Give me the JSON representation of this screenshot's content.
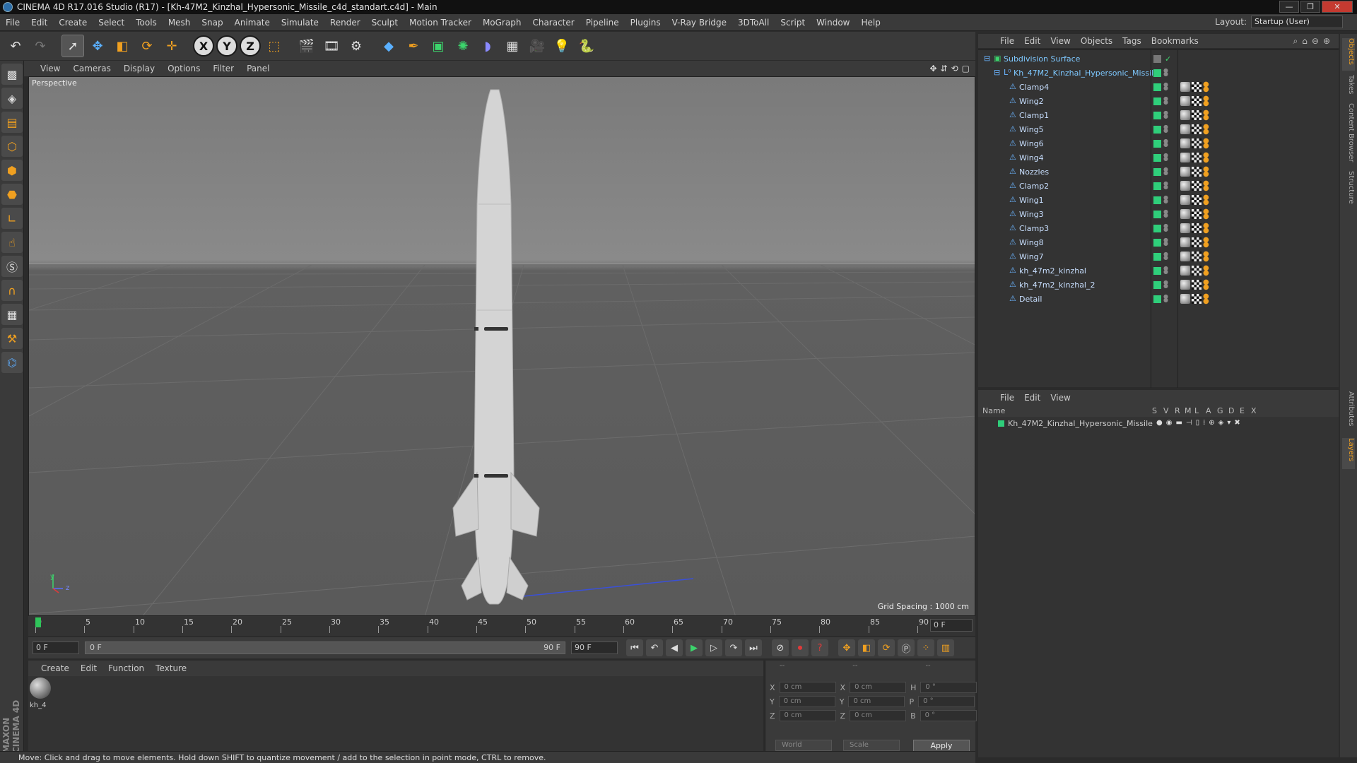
{
  "window": {
    "title": "CINEMA 4D R17.016 Studio (R17) - [Kh-47M2_Kinzhal_Hypersonic_Missile_c4d_standart.c4d] - Main"
  },
  "menubar": {
    "items": [
      "File",
      "Edit",
      "Create",
      "Select",
      "Tools",
      "Mesh",
      "Snap",
      "Animate",
      "Simulate",
      "Render",
      "Sculpt",
      "Motion Tracker",
      "MoGraph",
      "Character",
      "Pipeline",
      "Plugins",
      "V-Ray Bridge",
      "3DToAll",
      "Script",
      "Window",
      "Help"
    ],
    "layout_label": "Layout:",
    "layout_value": "Startup (User)"
  },
  "toolbar": {
    "icons": [
      "undo-icon",
      "redo-icon",
      "select-arrow-icon",
      "move-icon",
      "scale-icon",
      "rotate-icon",
      "add-icon",
      "x-axis-icon",
      "y-axis-icon",
      "z-axis-icon",
      "coordinate-system-icon",
      "render-view-icon",
      "render-picture-viewer-icon",
      "render-settings-icon",
      "cube-primitive-icon",
      "spline-pen-icon",
      "subdivision-icon",
      "cloner-icon",
      "deformer-icon",
      "floor-icon",
      "camera-icon",
      "light-icon",
      "python-icon"
    ],
    "axis_labels": [
      "X",
      "Y",
      "Z"
    ]
  },
  "left_tools": [
    "model-mode-icon",
    "texture-mode-icon",
    "workplane-icon",
    "points-mode-icon",
    "edges-mode-icon",
    "polygons-mode-icon",
    "axis-mode-icon",
    "tweak-icon",
    "soft-selection-icon",
    "magnet-icon",
    "snap-grid-icon",
    "snap-settings-icon",
    "python-script-icon"
  ],
  "viewport": {
    "menus": [
      "View",
      "Cameras",
      "Display",
      "Options",
      "Filter",
      "Panel"
    ],
    "label": "Perspective",
    "grid_spacing": "Grid Spacing : 1000 cm",
    "axis_y": "y",
    "axis_z": "z"
  },
  "timeline": {
    "ticks": [
      "0",
      "5",
      "10",
      "15",
      "20",
      "25",
      "30",
      "35",
      "40",
      "45",
      "50",
      "55",
      "60",
      "65",
      "70",
      "75",
      "80",
      "85",
      "90"
    ],
    "current_frame": "0 F",
    "end_frame_field": "0 F"
  },
  "transport": {
    "start_field": "0 F",
    "range_start": "0 F",
    "range_end": "90 F",
    "end_field": "90 F"
  },
  "material_manager": {
    "menus": [
      "Create",
      "Edit",
      "Function",
      "Texture"
    ],
    "material_name": "kh_4"
  },
  "coordinates": {
    "headers": [
      "--",
      "--",
      "--"
    ],
    "rows": [
      {
        "a": "X",
        "a_val": "0 cm",
        "b": "X",
        "b_val": "0 cm",
        "c": "H",
        "c_val": "0 °"
      },
      {
        "a": "Y",
        "a_val": "0 cm",
        "b": "Y",
        "b_val": "0 cm",
        "c": "P",
        "c_val": "0 °"
      },
      {
        "a": "Z",
        "a_val": "0 cm",
        "b": "Z",
        "b_val": "0 cm",
        "c": "B",
        "c_val": "0 °"
      }
    ],
    "world_dropdown": "World",
    "scale_dropdown": "Scale",
    "apply": "Apply"
  },
  "statusbar": {
    "text": "Move: Click and drag to move elements. Hold down SHIFT to quantize movement / add to the selection in point mode, CTRL to remove."
  },
  "object_manager": {
    "menus": [
      "File",
      "Edit",
      "View",
      "Objects",
      "Tags",
      "Bookmarks"
    ],
    "root": "Subdivision Surface",
    "group": "Kh_47M2_Kinzhal_Hypersonic_Missile",
    "children": [
      "Clamp4",
      "Wing2",
      "Clamp1",
      "Wing5",
      "Wing6",
      "Wing4",
      "Nozzles",
      "Clamp2",
      "Wing1",
      "Wing3",
      "Clamp3",
      "Wing8",
      "Wing7",
      "kh_47m2_kinzhal",
      "kh_47m2_kinzhal_2",
      "Detail"
    ]
  },
  "layer_manager": {
    "menus": [
      "File",
      "Edit",
      "View"
    ],
    "columns": {
      "name": "Name",
      "flags": [
        "S",
        "V",
        "R",
        "M",
        "L",
        "A",
        "G",
        "D",
        "E",
        "X"
      ]
    },
    "layer_name": "Kh_47M2_Kinzhal_Hypersonic_Missile"
  },
  "side_tabs": [
    "Objects",
    "Takes",
    "Content Browser",
    "Structure",
    "Attributes",
    "Layers"
  ],
  "colors": {
    "accent_green": "#2fce7a",
    "accent_orange": "#f0a020",
    "panel_bg": "#3a3a3a",
    "viewport_bg": "#6e6e6e"
  }
}
